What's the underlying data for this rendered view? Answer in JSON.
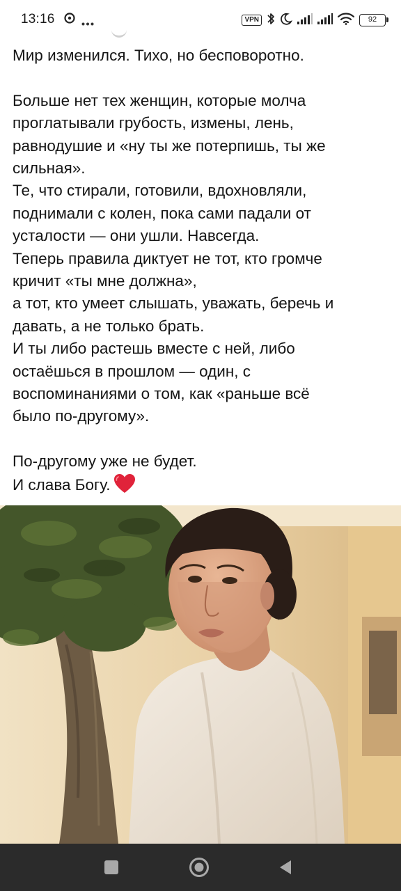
{
  "status_bar": {
    "time": "13:16",
    "left_icons": [
      "app-notification-icon",
      "more-notifications-icon"
    ],
    "vpn_label": "VPN",
    "right_icons": [
      "bluetooth-icon",
      "do-not-disturb-moon-icon",
      "signal-icon",
      "signal-icon",
      "wifi-icon"
    ],
    "battery_level": "92"
  },
  "post": {
    "paragraph_1": [
      "Мир изменился. Тихо, но бесповоротно."
    ],
    "paragraph_2": [
      "Больше нет тех женщин, которые молча",
      "проглатывали грубость, измены, лень,",
      "равнодушие и «ну ты же потерпишь, ты же",
      "сильная».",
      "Те, что стирали, готовили, вдохновляли,",
      "поднимали с колен, пока сами падали от",
      "усталости — они ушли. Навсегда.",
      "Теперь правила диктует не тот, кто громче",
      "кричит «ты мне должна»,",
      "а тот, кто умеет слышать, уважать, беречь и",
      "давать, а не только брать.",
      "И ты либо растешь вместе с ней, либо",
      "остаёшься в прошлом — один, с",
      "воспоминаниями о том, как «раньше всё",
      "было по-другому»."
    ],
    "paragraph_3": [
      "По-другому уже не будет.",
      "И слава Богу."
    ],
    "closing_emoji": "red-heart-icon"
  },
  "photo": {
    "subject": "woman-portrait-photo",
    "colors": {
      "wall": "#e8d2aa",
      "sweater": "#ece3d6",
      "hair": "#2a1d17",
      "skin": "#d9a07f",
      "foliage": "#44562a",
      "trunk": "#6d5b44"
    }
  },
  "nav_bar": {
    "buttons": [
      "recents-button",
      "home-button",
      "back-button"
    ],
    "background": "#2b2b2b"
  }
}
